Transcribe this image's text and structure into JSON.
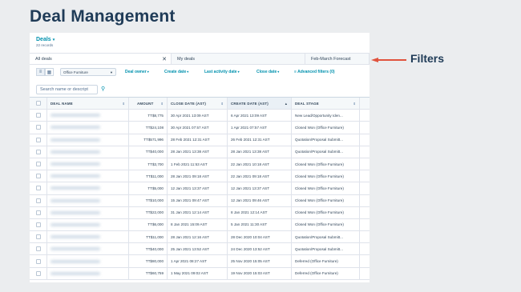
{
  "slide": {
    "title": "Deal Management",
    "annotation": "Filters"
  },
  "header": {
    "title": "Deals",
    "count": "22 records"
  },
  "tabs": [
    {
      "label": "All deals",
      "active": true
    },
    {
      "label": "My deals",
      "active": false
    },
    {
      "label": "Feb-March Forecast",
      "active": false
    }
  ],
  "toolbar": {
    "pipeline": "Office Furniture",
    "filters": [
      "Deal owner",
      "Create date",
      "Last activity date",
      "Close date"
    ],
    "advanced": "Advanced filters (0)"
  },
  "search": {
    "placeholder": "Search name or descript"
  },
  "table": {
    "headers": [
      "DEAL NAME",
      "AMOUNT",
      "CLOSE DATE (AST)",
      "CREATE DATE (AST)",
      "DEAL STAGE"
    ],
    "rows": [
      [
        "TT$8,775",
        "30 Apr 2021 13:09 AST",
        "6 Apr 2021 13:09 AST",
        "New Lead/Opportunity Iden..."
      ],
      [
        "TT$24,108",
        "30 Apr 2021 07:57 AST",
        "1 Apr 2021 07:57 AST",
        "Closed Won (Office Furniture)"
      ],
      [
        "TT$571,996",
        "28 Feb 2021 12:31 AST",
        "26 Feb 2021 12:31 AST",
        "Quotation/Proposal Submitt..."
      ],
      [
        "TT$40,000",
        "28 Jan 2021 13:38 AST",
        "28 Jan 2021 13:38 AST",
        "Quotation/Proposal Submitt..."
      ],
      [
        "TT$3,700",
        "1 Feb 2021 11:53 AST",
        "22 Jan 2021 10:18 AST",
        "Closed Won (Office Furniture)"
      ],
      [
        "TT$11,000",
        "28 Jan 2021 09:18 AST",
        "22 Jan 2021 09:18 AST",
        "Closed Won (Office Furniture)"
      ],
      [
        "TT$5,000",
        "12 Jan 2021 13:37 AST",
        "12 Jan 2021 13:37 AST",
        "Closed Won (Office Furniture)"
      ],
      [
        "TT$10,000",
        "15 Jan 2021 09:47 AST",
        "12 Jan 2021 09:46 AST",
        "Closed Won (Office Furniture)"
      ],
      [
        "TT$22,000",
        "31 Jan 2021 12:14 AST",
        "8 Jan 2021 12:14 AST",
        "Closed Won (Office Furniture)"
      ],
      [
        "TT$6,000",
        "8 Jan 2021 15:09 AST",
        "5 Jan 2021 11:30 AST",
        "Closed Won (Office Furniture)"
      ],
      [
        "TT$11,000",
        "28 Jan 2021 12:16 AST",
        "28 Dec 2020 10:04 AST",
        "Quotation/Proposal Submitt..."
      ],
      [
        "TT$40,000",
        "25 Jan 2021 13:52 AST",
        "24 Dec 2020 13:52 AST",
        "Quotation/Proposal Submitt..."
      ],
      [
        "TT$80,000",
        "1 Apr 2021 08:27 AST",
        "25 Nov 2020 15:05 AST",
        "Deferred (Office Furniture)"
      ],
      [
        "TT$60,759",
        "1 May 2021 09:02 AST",
        "19 Nov 2020 15:03 AST",
        "Deferred (Office Furniture)"
      ]
    ]
  },
  "colors": {
    "accent": "#0091ae",
    "title": "#1f3b57",
    "arrow": "#e0533d"
  }
}
